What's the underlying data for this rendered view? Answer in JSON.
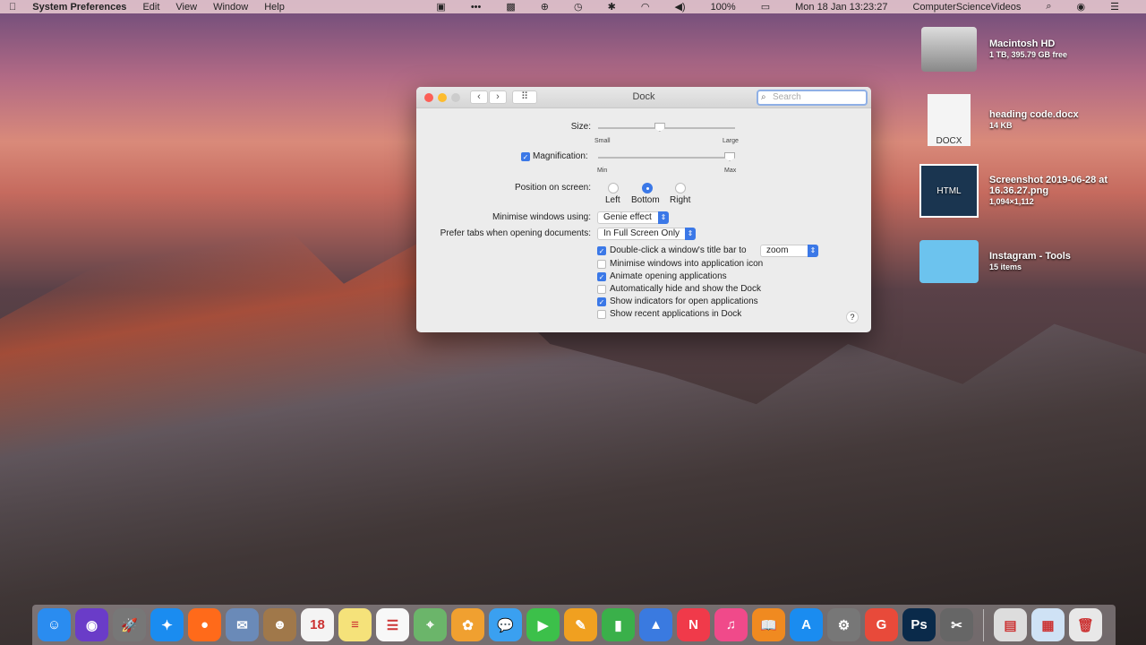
{
  "menubar": {
    "app": "System Preferences",
    "items": [
      "Edit",
      "View",
      "Window",
      "Help"
    ],
    "battery": "100%",
    "datetime": "Mon 18 Jan  13:23:27",
    "user": "ComputerScienceVideos"
  },
  "window": {
    "title": "Dock",
    "search_placeholder": "Search",
    "size_label": "Size:",
    "size_min": "Small",
    "size_max": "Large",
    "size_value": 0.45,
    "magnification_label": "Magnification:",
    "magnification_checked": true,
    "mag_min": "Min",
    "mag_max": "Max",
    "mag_value": 1.0,
    "position_label": "Position on screen:",
    "positions": [
      "Left",
      "Bottom",
      "Right"
    ],
    "position_selected": "Bottom",
    "minimise_label": "Minimise windows using:",
    "minimise_value": "Genie effect",
    "tabs_label": "Prefer tabs when opening documents:",
    "tabs_value": "In Full Screen Only",
    "dblclick_value": "zoom",
    "checkboxes": [
      {
        "label": "Double-click a window's title bar to",
        "checked": true
      },
      {
        "label": "Minimise windows into application icon",
        "checked": false
      },
      {
        "label": "Animate opening applications",
        "checked": true
      },
      {
        "label": "Automatically hide and show the Dock",
        "checked": false
      },
      {
        "label": "Show indicators for open applications",
        "checked": true
      },
      {
        "label": "Show recent applications in Dock",
        "checked": false
      }
    ],
    "help": "?"
  },
  "desktop": [
    {
      "name": "Macintosh HD",
      "info": "1 TB, 395.79 GB free"
    },
    {
      "name": "heading code.docx",
      "info": "14 KB",
      "badge": "DOCX"
    },
    {
      "name": "Screenshot 2019-06-28 at 16.36.27.png",
      "info": "1,094×1,112",
      "badge": "HTML"
    },
    {
      "name": "Instagram - Tools",
      "info": "15 items"
    }
  ],
  "dock": {
    "apps": [
      {
        "name": "Finder",
        "glyph": "☺",
        "color": "#2a8cf0"
      },
      {
        "name": "Siri",
        "glyph": "◉",
        "color": "#6a3cc8"
      },
      {
        "name": "Launchpad",
        "glyph": "🚀",
        "color": "#777"
      },
      {
        "name": "Safari",
        "glyph": "✦",
        "color": "#1a8cf0"
      },
      {
        "name": "Firefox",
        "glyph": "●",
        "color": "#ff6a1a"
      },
      {
        "name": "Mail",
        "glyph": "✉",
        "color": "#6a8ab8"
      },
      {
        "name": "Contacts",
        "glyph": "☻",
        "color": "#a0784a"
      },
      {
        "name": "Calendar",
        "glyph": "18",
        "color": "#f4f4f4"
      },
      {
        "name": "Notes",
        "glyph": "≡",
        "color": "#f5e27a"
      },
      {
        "name": "Reminders",
        "glyph": "☰",
        "color": "#f8f8f8"
      },
      {
        "name": "Maps",
        "glyph": "⌖",
        "color": "#6bb56a"
      },
      {
        "name": "Photos",
        "glyph": "✿",
        "color": "#f0a030"
      },
      {
        "name": "Messages",
        "glyph": "💬",
        "color": "#3aa0f0"
      },
      {
        "name": "FaceTime",
        "glyph": "▶",
        "color": "#3cc04a"
      },
      {
        "name": "Pages",
        "glyph": "✎",
        "color": "#f0a020"
      },
      {
        "name": "Numbers",
        "glyph": "▮",
        "color": "#3ab04a"
      },
      {
        "name": "Keynote",
        "glyph": "▲",
        "color": "#3a7ae0"
      },
      {
        "name": "News",
        "glyph": "N",
        "color": "#f03a4a"
      },
      {
        "name": "Music",
        "glyph": "♫",
        "color": "#f04a8a"
      },
      {
        "name": "Books",
        "glyph": "📖",
        "color": "#f08a20"
      },
      {
        "name": "App Store",
        "glyph": "A",
        "color": "#1a8cf0"
      },
      {
        "name": "System Preferences",
        "glyph": "⚙",
        "color": "#777"
      },
      {
        "name": "Chrome",
        "glyph": "G",
        "color": "#e84a3a"
      },
      {
        "name": "Photoshop",
        "glyph": "Ps",
        "color": "#0a2a4a"
      },
      {
        "name": "Screenshot",
        "glyph": "✂",
        "color": "#666"
      }
    ],
    "others": [
      {
        "name": "Documents",
        "glyph": "▤",
        "color": "#ddd"
      },
      {
        "name": "Downloads",
        "glyph": "▦",
        "color": "#cfe2f5"
      },
      {
        "name": "Trash",
        "glyph": "🗑",
        "color": "#e8e8e8"
      }
    ]
  }
}
